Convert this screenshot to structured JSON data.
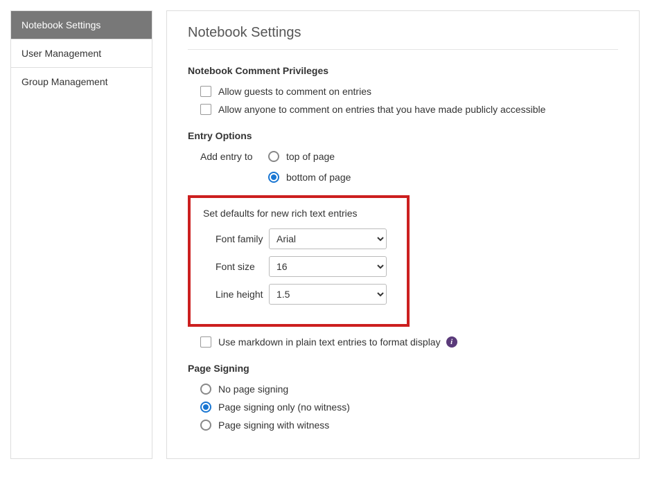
{
  "sidebar": {
    "items": [
      {
        "label": "Notebook Settings"
      },
      {
        "label": "User Management"
      },
      {
        "label": "Group Management"
      }
    ]
  },
  "page": {
    "title": "Notebook Settings"
  },
  "privileges": {
    "heading": "Notebook Comment Privileges",
    "allow_guests_label": "Allow guests to comment on entries",
    "allow_anyone_label": "Allow anyone to comment on entries that you have made publicly accessible"
  },
  "entry": {
    "heading": "Entry Options",
    "add_entry_label": "Add entry to",
    "top_label": "top of page",
    "bottom_label": "bottom of page"
  },
  "defaults": {
    "heading": "Set defaults for new rich text entries",
    "font_family_label": "Font family",
    "font_family_value": "Arial",
    "font_size_label": "Font size",
    "font_size_value": "16",
    "line_height_label": "Line height",
    "line_height_value": "1.5"
  },
  "markdown": {
    "label": "Use markdown in plain text entries to format display"
  },
  "signing": {
    "heading": "Page Signing",
    "none_label": "No page signing",
    "only_label": "Page signing only (no witness)",
    "witness_label": "Page signing with witness"
  }
}
